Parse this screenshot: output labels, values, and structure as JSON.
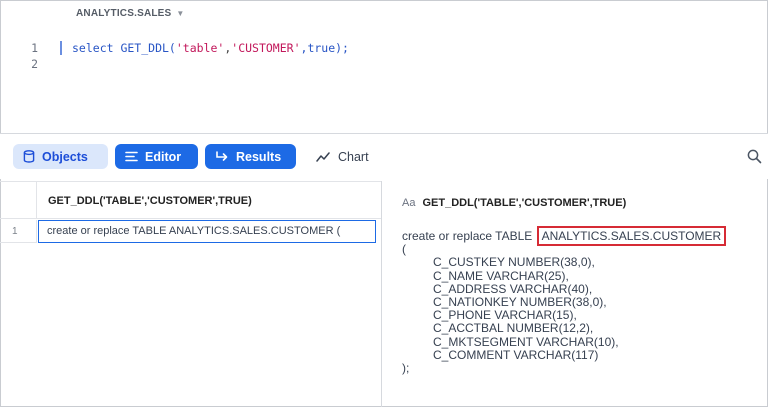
{
  "worksheet": {
    "context_label": "ANALYTICS.SALES",
    "code_lines": [
      {
        "num": "1"
      },
      {
        "num": "2"
      }
    ],
    "code": {
      "fn": "select GET_DDL(",
      "arg1": "'table'",
      "sep1": ",",
      "arg2": "'CUSTOMER'",
      "rest": ",true);"
    }
  },
  "toolbar": {
    "objects_label": "Objects",
    "editor_label": "Editor",
    "results_label": "Results",
    "chart_label": "Chart",
    "accent": "#1d6ae5"
  },
  "results": {
    "column_header": "GET_DDL('TABLE','CUSTOMER',TRUE)",
    "rows": [
      {
        "num": "1",
        "value": "create or replace TABLE ANALYTICS.SALES.CUSTOMER ("
      }
    ]
  },
  "detail": {
    "type_icon": "Aa",
    "title": "GET_DDL('TABLE','CUSTOMER',TRUE)",
    "ddl_prefix": "create or replace TABLE ",
    "ddl_table": "ANALYTICS.SALES.CUSTOMER",
    "open_paren": "(",
    "columns": [
      "C_CUSTKEY NUMBER(38,0),",
      "C_NAME VARCHAR(25),",
      "C_ADDRESS VARCHAR(40),",
      "C_NATIONKEY NUMBER(38,0),",
      "C_PHONE VARCHAR(15),",
      "C_ACCTBAL NUMBER(12,2),",
      "C_MKTSEGMENT VARCHAR(10),",
      "C_COMMENT VARCHAR(117)"
    ],
    "close": ");",
    "highlight_color": "#d62b35"
  }
}
